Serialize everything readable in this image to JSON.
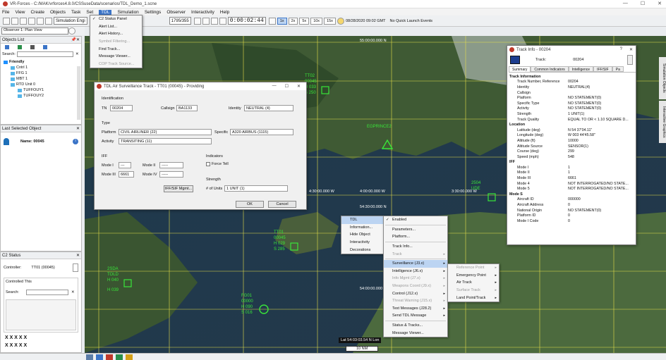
{
  "window": {
    "title": "VR-Forces - C:/MAK/vrforces4.8.0/CSSuseData/scenarios/TDL_Demo_1.scne"
  },
  "menubar": [
    "File",
    "View",
    "Create",
    "Objects",
    "Task",
    "Set",
    "TDL",
    "Simulation",
    "Settings",
    "Observer",
    "Interactivity",
    "Help"
  ],
  "toolbar": {
    "sim_engine": "Simulation Engi",
    "frame": "1795/355",
    "time": "0:00:02:44",
    "speeds": [
      "1x",
      "2x",
      "5x",
      "10x",
      "15x"
    ],
    "date": "08/28/2020 09:02 GMT",
    "quick_launch": "No Quick Launch Events"
  },
  "tdl_menu": {
    "items": [
      {
        "label": "C2 Status Panel",
        "checked": true
      },
      {
        "label": "Alert List..."
      },
      {
        "label": "Alert History..."
      },
      {
        "label": "Symbol Filtering...",
        "disabled": true
      },
      {
        "label": "Find Track..."
      },
      {
        "label": "Message Viewer..."
      },
      {
        "label": "COP Track Source...",
        "disabled": true
      }
    ]
  },
  "observer": {
    "label": "Observer 1: Plan View"
  },
  "objects_panel": {
    "title": "Objects List",
    "search_label": "Search:",
    "tree": [
      {
        "label": "Friendly",
        "level": 1,
        "bold": true
      },
      {
        "label": "Cntrl 1",
        "level": 2
      },
      {
        "label": "FFG 1",
        "level": 2
      },
      {
        "label": "MBT 1",
        "level": 2
      },
      {
        "label": "RTD Unit 0",
        "level": 2
      },
      {
        "label": "TUFFOUY1",
        "level": 3
      },
      {
        "label": "TUFFOUY2",
        "level": 3
      }
    ]
  },
  "last_selected": {
    "title": "Last Selected Object",
    "name_label": "Name:",
    "name_value": "00045"
  },
  "c2_status": {
    "title": "C2 Status",
    "controller_label": "Controller:",
    "controller_value": "TT01 (00045)",
    "controlled_label": "Controlled This",
    "search_label": "Search:",
    "x_rows": [
      "X X X X X",
      "X X X X X"
    ]
  },
  "tdl_dialog": {
    "title": "TDL Air Surveillance Track - TT01 (00045) - Providing",
    "identification": "Identification",
    "tn_label": "TN",
    "tn_value": "00204",
    "callsign_label": "Callsign",
    "callsign_value": "BA1133",
    "identity_label": "Identity",
    "identity_value": "NEUTRAL (4)",
    "type_label": "Type",
    "platform_label": "Platform",
    "platform_value": "CIVIL AIRLINER (22)",
    "specific_label": "Specific",
    "specific_value": "A320 AIRBUS (1115)",
    "activity_label": "Activity",
    "activity_value": "TRANSITING (11)",
    "iff_label": "IFF",
    "mode1_label": "Mode I",
    "mode1_value": "---",
    "mode2_label": "Mode II",
    "mode2_value": "-----",
    "mode3_label": "Mode III",
    "mode3_value": "6661",
    "mode4_label": "Mode IV",
    "mode4_value": "-----",
    "indicators_label": "Indicators",
    "force_tell_label": "Force Tell",
    "strength_label": "Strength",
    "units_label": "# of Units",
    "units_value": "1 UNIT (1)",
    "ppsf_btn": "IFF/SIF Mgmt...",
    "ok": "OK",
    "cancel": "Cancel"
  },
  "context_menu": {
    "main": [
      {
        "label": "TDL",
        "arrow": true,
        "highlight": true
      },
      {
        "label": "Information..."
      },
      {
        "label": "Hide Object"
      },
      {
        "label": "Interactivity",
        "arrow": true
      },
      {
        "label": "Decorations",
        "arrow": true
      }
    ],
    "tdl": [
      {
        "label": "Enabled",
        "checked": true
      },
      {
        "label": "sep"
      },
      {
        "label": "Parameters..."
      },
      {
        "label": "Platform..."
      },
      {
        "label": "sep"
      },
      {
        "label": "Track Info..."
      },
      {
        "label": "Track",
        "disabled": true,
        "arrow": true
      },
      {
        "label": "sep"
      },
      {
        "label": "Surveillance (J3.x)",
        "arrow": true,
        "highlight": true
      },
      {
        "label": "Intelligence (J6.x)",
        "arrow": true
      },
      {
        "label": "Info Mgmt (J7.x)",
        "disabled": true,
        "arrow": true
      },
      {
        "label": "Weapons Coord (J9.x)",
        "disabled": true,
        "arrow": true
      },
      {
        "label": "Control (J12.x)",
        "arrow": true
      },
      {
        "label": "Threat Warning (J15.x)",
        "disabled": true,
        "arrow": true
      },
      {
        "label": "Text Messages (J28.2)",
        "arrow": true
      },
      {
        "label": "Send TDL Message",
        "arrow": true
      },
      {
        "label": "sep"
      },
      {
        "label": "Status & Tracks..."
      },
      {
        "label": "Message Viewer..."
      }
    ],
    "surveillance": [
      {
        "label": "Reference Point",
        "disabled": true,
        "arrow": true
      },
      {
        "label": "Emergency Point",
        "arrow": true
      },
      {
        "label": "Air Track",
        "arrow": true
      },
      {
        "label": "Surface Track",
        "disabled": true,
        "arrow": true
      },
      {
        "label": "Land Point/Track",
        "arrow": true
      }
    ]
  },
  "track_info": {
    "title": "Track Info - 00204",
    "track_label": "Track:",
    "track_value": "00204",
    "tabs": [
      "Summary",
      "Common Indicators",
      "Intelligence",
      "IFF/SIF",
      "Pa"
    ],
    "rows": [
      {
        "k": "Track Information",
        "v": "",
        "sec": true
      },
      {
        "k": "Track Number, Reference",
        "v": "00204"
      },
      {
        "k": "Identity",
        "v": "NEUTRAL(4)"
      },
      {
        "k": "Callsign",
        "v": ""
      },
      {
        "k": "Platform",
        "v": "NO STATEMENT(0)"
      },
      {
        "k": "Specific Type",
        "v": "NO STATEMENT(0)"
      },
      {
        "k": "Activity",
        "v": "NO STATEMENT(0)"
      },
      {
        "k": "Strength",
        "v": "1 UNIT(1)"
      },
      {
        "k": "Track Quality",
        "v": "EQUAL TO OR < 1.10 SQUARE D..."
      },
      {
        "k": "Location",
        "v": "",
        "sec": true
      },
      {
        "k": "Latitude (deg)",
        "v": "N 54 37'04.11\""
      },
      {
        "k": "Longitude (deg)",
        "v": "W 003 44'45.58\""
      },
      {
        "k": "Altitude (ft)",
        "v": "10000"
      },
      {
        "k": "Altitude Source",
        "v": "SENSOR(1)"
      },
      {
        "k": "Course (deg)",
        "v": "299"
      },
      {
        "k": "Speed (mph)",
        "v": "548"
      },
      {
        "k": "IFF",
        "v": "",
        "sec": true
      },
      {
        "k": "Mode I",
        "v": "1"
      },
      {
        "k": "Mode II",
        "v": "1"
      },
      {
        "k": "Mode III",
        "v": "6661"
      },
      {
        "k": "Mode 4",
        "v": "NOT INTERROGATED/NO STATE..."
      },
      {
        "k": "Mode 5",
        "v": "NOT INTERROGATED/NO STATE..."
      },
      {
        "k": "Mode S",
        "v": "",
        "sec": true
      },
      {
        "k": "Aircraft ID",
        "v": "000000"
      },
      {
        "k": "Aircraft Address",
        "v": "0"
      },
      {
        "k": "National Origin",
        "v": "NO STATEMENT(0)"
      },
      {
        "k": "Platform ID",
        "v": "0"
      },
      {
        "k": "Mode I Code",
        "v": "0"
      }
    ]
  },
  "map": {
    "grid_labels": [
      "55:00:00.000 N",
      "4:30:00.000 W",
      "4:00:00.000 W",
      "3:30:00.000 W",
      "54:30:00.000 N",
      "54:00:00.000 N"
    ],
    "tracks": [
      {
        "lines": [
          "TT02",
          "00045",
          "H 033",
          "S 250"
        ],
        "color": "#39e639"
      },
      {
        "lines": [
          "EGPRINCE2"
        ],
        "color": "#39e639"
      },
      {
        "lines": [
          "TT01",
          "00045",
          "H 029",
          "S 285"
        ],
        "color": "#39e639"
      },
      {
        "lines": [
          "FG01",
          "00000",
          "H 090",
          "S 016"
        ],
        "color": "#39e639"
      },
      {
        "lines": [
          "2SDA",
          "TOLD",
          "H 040"
        ],
        "color": "#39e639"
      },
      {
        "lines": [
          "H 039"
        ],
        "color": "#39e639"
      },
      {
        "lines": [
          "2504",
          "UDE"
        ],
        "color": "#39e639"
      }
    ],
    "coord_readout": "Lat 54:03:03.54 N Lon",
    "scale": "10 NM",
    "side_tabs": [
      "Simulation Objects",
      "Interactive Graphics"
    ]
  },
  "colors": {
    "accent": "#3b74c7",
    "track": "#39e639",
    "friendly": "#55b5e8"
  }
}
